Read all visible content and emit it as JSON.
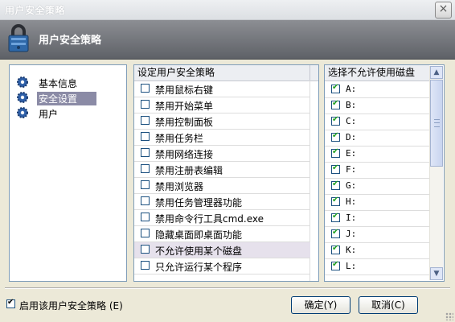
{
  "window": {
    "title": "用户安全策略",
    "close_glyph": "×"
  },
  "header": {
    "title": "用户安全策略",
    "icon": "lock-icon"
  },
  "nav": {
    "items": [
      {
        "label": "基本信息",
        "icon": "gear-icon",
        "selected": false
      },
      {
        "label": "安全设置",
        "icon": "gear-icon",
        "selected": true
      },
      {
        "label": "用户",
        "icon": "gear-icon",
        "selected": false
      }
    ]
  },
  "policies": {
    "header": "设定用户安全策略",
    "items": [
      {
        "label": "禁用鼠标右键",
        "checked": false
      },
      {
        "label": "禁用开始菜单",
        "checked": false
      },
      {
        "label": "禁用控制面板",
        "checked": false
      },
      {
        "label": "禁用任务栏",
        "checked": false
      },
      {
        "label": "禁用网络连接",
        "checked": false
      },
      {
        "label": "禁用注册表编辑",
        "checked": false
      },
      {
        "label": "禁用浏览器",
        "checked": false
      },
      {
        "label": "禁用任务管理器功能",
        "checked": false
      },
      {
        "label": "禁用命令行工具cmd.exe",
        "checked": false
      },
      {
        "label": "隐藏桌面即桌面功能",
        "checked": false
      },
      {
        "label": "不允许使用某个磁盘",
        "checked": false,
        "highlighted": true
      },
      {
        "label": "只允许运行某个程序",
        "checked": false
      }
    ]
  },
  "drives": {
    "header": "选择不允许使用磁盘",
    "items": [
      {
        "label": "A:",
        "checked": true
      },
      {
        "label": "B:",
        "checked": true
      },
      {
        "label": "C:",
        "checked": true
      },
      {
        "label": "D:",
        "checked": true
      },
      {
        "label": "E:",
        "checked": true
      },
      {
        "label": "F:",
        "checked": true
      },
      {
        "label": "G:",
        "checked": true
      },
      {
        "label": "H:",
        "checked": true
      },
      {
        "label": "I:",
        "checked": true
      },
      {
        "label": "J:",
        "checked": true
      },
      {
        "label": "K:",
        "checked": true
      },
      {
        "label": "L:",
        "checked": true
      }
    ]
  },
  "footer": {
    "enable_label": "启用该用户安全策略 (E)",
    "enable_checked": true,
    "ok_label": "确定(Y)",
    "cancel_label": "取消(C)"
  },
  "colors": {
    "header_bg": "#6e7176",
    "selection": "#8b8ba6",
    "check": "#21a121",
    "border": "#7f9db9"
  }
}
